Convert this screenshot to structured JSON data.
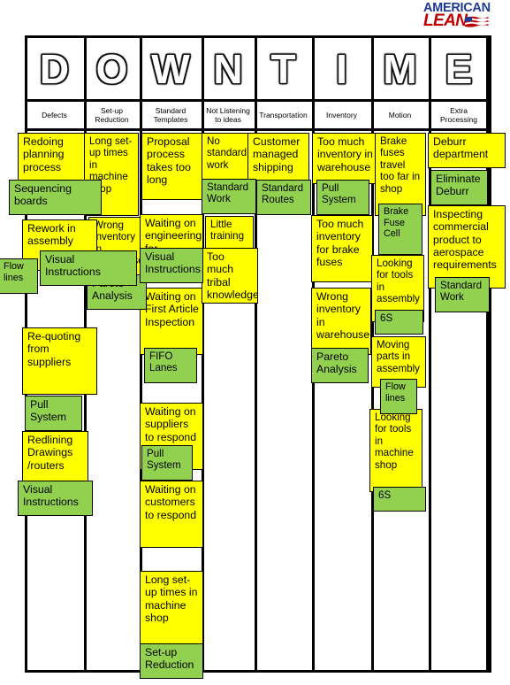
{
  "logo": {
    "line1": "AMERICAN",
    "line2": "LEAN",
    "flag_icon": "usa-flag-icon"
  },
  "board": {
    "acronym": "DOWNTIME",
    "letters": [
      "D",
      "O",
      "W",
      "N",
      "T",
      "I",
      "M",
      "E"
    ],
    "categories": [
      {
        "label": "Defects",
        "highlight": false
      },
      {
        "label": "Set-up Reduction",
        "highlight": true
      },
      {
        "label": "Standard Templates",
        "highlight": true
      },
      {
        "label": "Not Listening to ideas",
        "highlight": false
      },
      {
        "label": "Transportation",
        "highlight": false
      },
      {
        "label": "Inventory",
        "highlight": false
      },
      {
        "label": "Motion",
        "highlight": false
      },
      {
        "label": "Extra Processing",
        "highlight": false
      }
    ]
  },
  "colors": {
    "waste_note": "#FFFF00",
    "countermeasure_note": "#92D050",
    "border": "#000000",
    "logo_blue": "#1F3A93",
    "logo_red": "#C00000"
  },
  "columns": [
    {
      "key": "defects",
      "notes": [
        {
          "text": "Redoing planning process",
          "type": "waste"
        },
        {
          "text": "Sequencing boards",
          "type": "countermeasure"
        },
        {
          "text": "Rework in assembly",
          "type": "waste"
        },
        {
          "text": "Flow lines",
          "type": "countermeasure"
        },
        {
          "text": "Visual Instructions",
          "type": "countermeasure"
        },
        {
          "text": "Re-quoting from suppliers",
          "type": "waste"
        },
        {
          "text": "Pull System",
          "type": "countermeasure"
        },
        {
          "text": "Redlining Drawings /routers",
          "type": "waste"
        },
        {
          "text": "Visual Instructions",
          "type": "countermeasure"
        }
      ]
    },
    {
      "key": "setup-reduction",
      "notes": [
        {
          "text": "Long set-up times in machine shop",
          "type": "waste"
        },
        {
          "text": "Wrong inventory in warehouse",
          "type": "waste"
        },
        {
          "text": "Pareto Analysis",
          "type": "countermeasure"
        }
      ]
    },
    {
      "key": "standard-templates",
      "notes": [
        {
          "text": "Proposal process takes too long",
          "type": "waste"
        },
        {
          "text": "Waiting on engineering for answers",
          "type": "waste"
        },
        {
          "text": "Visual Instructions",
          "type": "countermeasure"
        },
        {
          "text": "Waiting on First Article Inspection",
          "type": "waste"
        },
        {
          "text": "FIFO Lanes",
          "type": "countermeasure"
        },
        {
          "text": "Waiting on suppliers to respond",
          "type": "waste"
        },
        {
          "text": "Pull System",
          "type": "countermeasure"
        },
        {
          "text": "Waiting on customers to respond",
          "type": "waste"
        },
        {
          "text": "Long set-up times in machine shop",
          "type": "waste"
        },
        {
          "text": "Set-up Reduction",
          "type": "countermeasure"
        }
      ]
    },
    {
      "key": "not-listening-to-ideas",
      "notes": [
        {
          "text": "No standard work",
          "type": "waste"
        },
        {
          "text": "Standard Work",
          "type": "countermeasure"
        },
        {
          "text": "Little training",
          "type": "waste"
        },
        {
          "text": "Too much tribal knowledge",
          "type": "waste"
        }
      ]
    },
    {
      "key": "transportation",
      "notes": [
        {
          "text": "Customer managed shipping",
          "type": "waste"
        },
        {
          "text": "Standard Routes",
          "type": "countermeasure"
        }
      ]
    },
    {
      "key": "inventory",
      "notes": [
        {
          "text": "Too much inventory in warehouse",
          "type": "waste"
        },
        {
          "text": "Pull System",
          "type": "countermeasure"
        },
        {
          "text": "Too much inventory for brake fuses",
          "type": "waste"
        },
        {
          "text": "Wrong inventory in warehouse",
          "type": "waste"
        },
        {
          "text": "Pareto Analysis",
          "type": "countermeasure"
        }
      ]
    },
    {
      "key": "motion",
      "notes": [
        {
          "text": "Brake fuses travel too far in shop",
          "type": "waste"
        },
        {
          "text": "Brake Fuse Cell",
          "type": "countermeasure"
        },
        {
          "text": "Looking for tools in assembly",
          "type": "waste"
        },
        {
          "text": "6S",
          "type": "countermeasure"
        },
        {
          "text": "Moving parts in assembly",
          "type": "waste"
        },
        {
          "text": "Flow lines",
          "type": "countermeasure"
        },
        {
          "text": "Looking for tools in machine shop",
          "type": "waste"
        },
        {
          "text": "6S",
          "type": "countermeasure"
        }
      ]
    },
    {
      "key": "extra-processing",
      "notes": [
        {
          "text": "Deburr department",
          "type": "waste"
        },
        {
          "text": "Eliminate Deburr",
          "type": "countermeasure"
        },
        {
          "text": "Inspecting commercial product to aerospace requirements",
          "type": "waste"
        },
        {
          "text": "Standard Work",
          "type": "countermeasure"
        }
      ]
    }
  ]
}
